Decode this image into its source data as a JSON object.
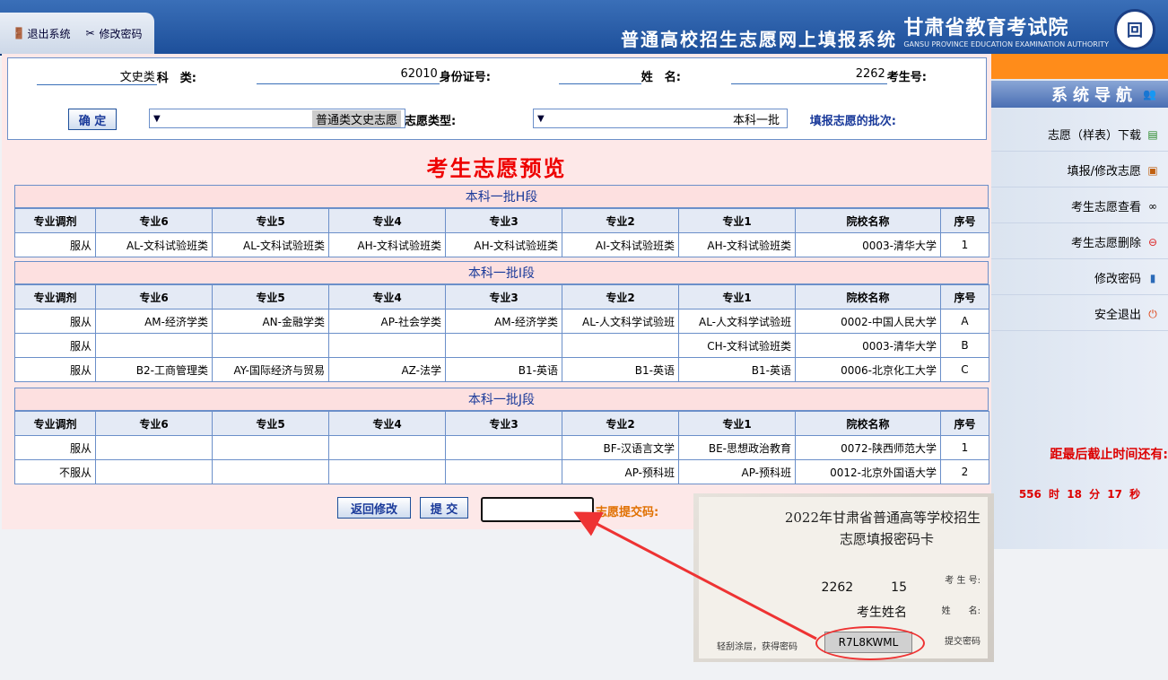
{
  "header": {
    "logo_emblem": "回",
    "logo_text": "甘肃省教育考试院",
    "logo_sub": "GANSU PROVINCE EDUCATION EXAMINATION AUTHORITY",
    "title": "普通高校招生志愿网上填报系统",
    "links": {
      "change_pwd": "修改密码",
      "logout": "退出系统"
    }
  },
  "info": {
    "exam_no_label": "考生号:",
    "exam_no": "2262",
    "name_label": "姓　名:",
    "name": "",
    "id_label": "身份证号:",
    "id": "62010",
    "subject_label": "科　类:",
    "subject": "文史类"
  },
  "selectors": {
    "batch_label": "填报志愿的批次:",
    "batch_value": "本科一批",
    "type_label": "志愿类型:",
    "type_value": "普通类文史志愿",
    "confirm": "确 定"
  },
  "preview_title": "考生志愿预览",
  "headers": [
    "序号",
    "院校名称",
    "专业1",
    "专业2",
    "专业3",
    "专业4",
    "专业5",
    "专业6",
    "专业调剂"
  ],
  "groups": [
    {
      "title": "本科一批H段",
      "rows": [
        [
          "1",
          "0003-清华大学",
          "AH-文科试验班类",
          "AI-文科试验班类",
          "AH-文科试验班类",
          "AH-文科试验班类",
          "AL-文科试验班类",
          "AL-文科试验班类",
          "服从"
        ]
      ]
    },
    {
      "title": "本科一批I段",
      "rows": [
        [
          "A",
          "0002-中国人民大学",
          "AL-人文科学试验班",
          "AL-人文科学试验班",
          "AM-经济学类",
          "AP-社会学类",
          "AN-金融学类",
          "AM-经济学类",
          "服从"
        ],
        [
          "B",
          "0003-清华大学",
          "CH-文科试验班类",
          "",
          "",
          "",
          "",
          "",
          "服从"
        ],
        [
          "C",
          "0006-北京化工大学",
          "B1-英语",
          "B1-英语",
          "B1-英语",
          "AZ-法学",
          "AY-国际经济与贸易",
          "B2-工商管理类",
          "服从"
        ]
      ]
    },
    {
      "title": "本科一批J段",
      "rows": [
        [
          "1",
          "0072-陕西师范大学",
          "BE-思想政治教育",
          "BF-汉语言文学",
          "",
          "",
          "",
          "",
          "服从"
        ],
        [
          "2",
          "0012-北京外国语大学",
          "AP-预科班",
          "AP-预科班",
          "",
          "",
          "",
          "",
          "不服从"
        ]
      ]
    }
  ],
  "submit": {
    "pw_label": "志愿提交码:",
    "pw_value": "",
    "submit": "提 交",
    "back": "返回修改"
  },
  "sidebar": {
    "nav_title": "系统导航",
    "items": [
      "志愿（样表）下载",
      "填报/修改志愿",
      "考生志愿查看",
      "考生志愿删除",
      "修改密码",
      "安全退出"
    ],
    "deadline_label": "距最后截止时间还有:",
    "countdown": "556 时 18 分 17 秒"
  },
  "photo": {
    "title1": "2022年甘肃省普通高等学校招生",
    "title2": "志愿填报密码卡",
    "exam_no_label": "考 生 号:",
    "exam_no": "2262　　　15",
    "name_label": "姓　　名:",
    "name": "考生姓名",
    "pw_label": "提交密码",
    "pw": "R7L8KWML",
    "note": "轻刮涂层，获得密码"
  }
}
